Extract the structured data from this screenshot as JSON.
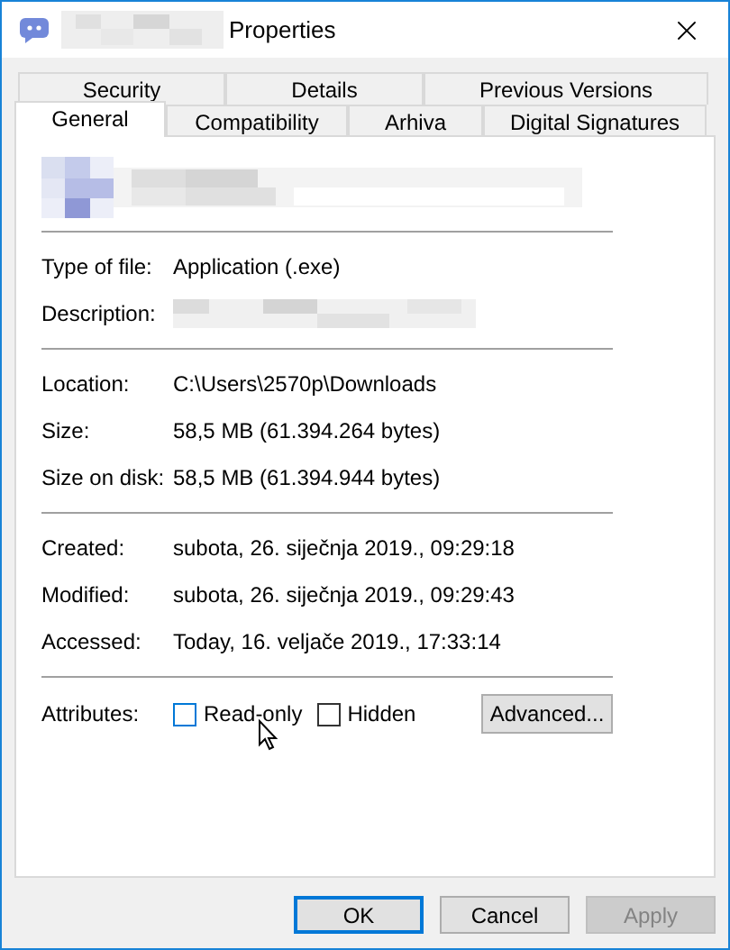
{
  "window": {
    "title": "Properties"
  },
  "tab_rows": [
    [
      {
        "label": "Security",
        "selected": false
      },
      {
        "label": "Details",
        "selected": false
      },
      {
        "label": "Previous Versions",
        "selected": false
      }
    ],
    [
      {
        "label": "General",
        "selected": true
      },
      {
        "label": "Compatibility",
        "selected": false
      },
      {
        "label": "Arhiva",
        "selected": false
      },
      {
        "label": "Digital Signatures",
        "selected": false
      }
    ]
  ],
  "groups": [
    [
      {
        "label": "Type of file:",
        "kind": "text",
        "value": "Application (.exe)"
      },
      {
        "label": "Description:",
        "kind": "redacted"
      }
    ],
    [
      {
        "label": "Location:",
        "kind": "text",
        "value": "C:\\Users\\2570p\\Downloads"
      },
      {
        "label": "Size:",
        "kind": "text",
        "value": "58,5 MB (61.394.264 bytes)"
      },
      {
        "label": "Size on disk:",
        "kind": "text",
        "value": "58,5 MB (61.394.944 bytes)"
      }
    ],
    [
      {
        "label": "Created:",
        "kind": "text",
        "value": "subota, 26. siječnja 2019., 09:29:18"
      },
      {
        "label": "Modified:",
        "kind": "text",
        "value": "subota, 26. siječnja 2019., 09:29:43"
      },
      {
        "label": "Accessed:",
        "kind": "text",
        "value": "Today, 16. veljače 2019., 17:33:14"
      }
    ]
  ],
  "attributes": {
    "label": "Attributes:",
    "checkboxes": [
      {
        "label": "Read-only",
        "checked": false,
        "focused": true
      },
      {
        "label": "Hidden",
        "checked": false,
        "focused": false
      }
    ],
    "advanced": "Advanced..."
  },
  "buttons": [
    {
      "label": "OK",
      "kind": "default"
    },
    {
      "label": "Cancel",
      "kind": "normal"
    },
    {
      "label": "Apply",
      "kind": "disabled"
    }
  ]
}
